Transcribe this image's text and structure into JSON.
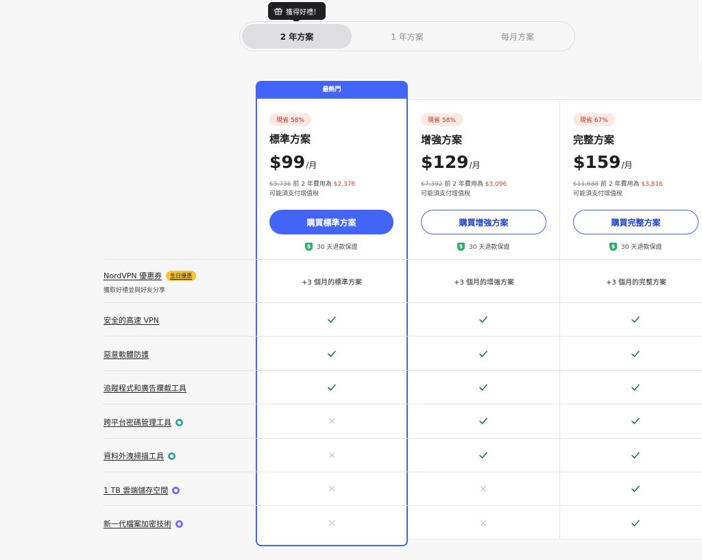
{
  "tooltip": {
    "text": "獲得好禮！",
    "icon": "gift-icon"
  },
  "period_tabs": [
    {
      "label": "2 年方案",
      "active": true
    },
    {
      "label": "1 年方案",
      "active": false
    },
    {
      "label": "每月方案",
      "active": false
    }
  ],
  "popular_label": "最熱門",
  "plans": [
    {
      "badge": "現省 58%",
      "name": "標準方案",
      "price": "$99",
      "unit": "/月",
      "old_price": "$5,736",
      "term_text": "前 2 年費用為",
      "term_price": "$2,376",
      "vat": "可能須支付增值稅",
      "button": "購買標準方案",
      "guarantee": "30 天退款保證",
      "addon": "+3 個月的標準方案"
    },
    {
      "badge": "現省 58%",
      "name": "增強方案",
      "price": "$129",
      "unit": "/月",
      "old_price": "$7,392",
      "term_text": "前 2 年費用為",
      "term_price": "$3,096",
      "vat": "可能須支付增值稅",
      "button": "購買增強方案",
      "guarantee": "30 天退款保證",
      "addon": "+3 個月的增強方案"
    },
    {
      "badge": "現省 67%",
      "name": "完整方案",
      "price": "$159",
      "unit": "/月",
      "old_price": "$11,688",
      "term_text": "前 2 年費用為",
      "term_price": "$3,816",
      "vat": "可能須支付增值稅",
      "button": "購買完整方案",
      "guarantee": "30 天退款保證",
      "addon": "+3 個月的完整方案"
    }
  ],
  "coupon_row": {
    "label": "NordVPN 優惠券",
    "badge": "生日優惠",
    "sub": "獲取好禮並與好友分享"
  },
  "features": [
    {
      "label": "安全的高速 VPN",
      "icon": "",
      "included": [
        true,
        true,
        true
      ]
    },
    {
      "label": "惡意軟體防護",
      "icon": "",
      "included": [
        true,
        true,
        true
      ]
    },
    {
      "label": "追蹤程式和廣告攔截工具",
      "icon": "",
      "included": [
        true,
        true,
        true
      ]
    },
    {
      "label": "跨平台密碼管理工具",
      "icon": "nordpass-icon",
      "included": [
        false,
        true,
        true
      ]
    },
    {
      "label": "資料外洩掃描工具",
      "icon": "nordpass-icon",
      "included": [
        false,
        true,
        true
      ]
    },
    {
      "label": "1 TB 雲端儲存空間",
      "icon": "nordlocker-icon",
      "included": [
        false,
        false,
        true
      ]
    },
    {
      "label": "新一代檔案加密技術",
      "icon": "nordlocker-icon",
      "included": [
        false,
        false,
        true
      ]
    }
  ],
  "colors": {
    "accent": "#4364f7",
    "check": "#1f7a4d",
    "cross": "#c8c8ce",
    "badge_bg": "#fde8e4",
    "sale_red": "#d2412b"
  }
}
